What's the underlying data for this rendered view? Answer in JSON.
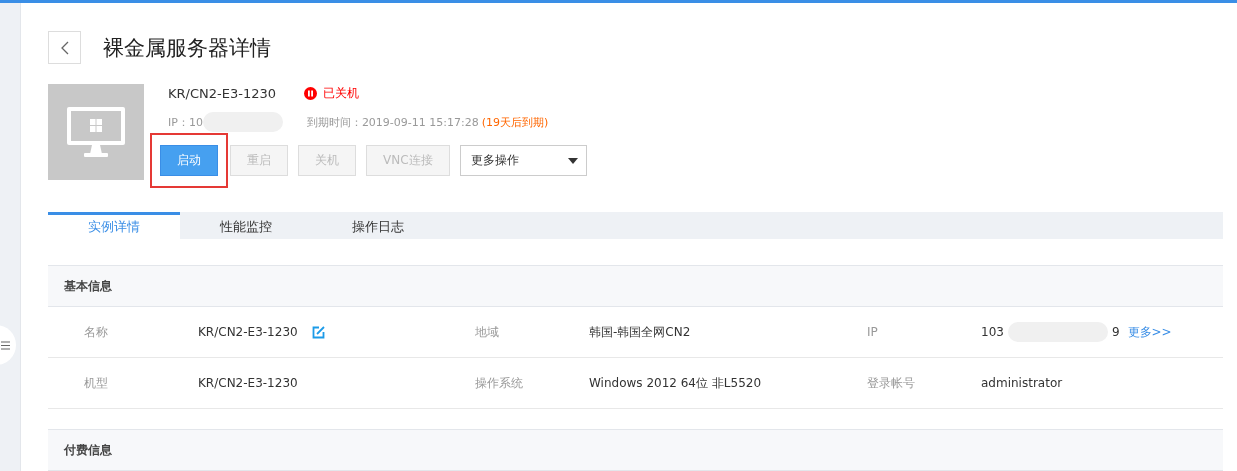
{
  "page": {
    "title": "裸金属服务器详情"
  },
  "server": {
    "name": "KR/CN2-E3-1230",
    "status": {
      "label": "已关机",
      "kind": "stopped"
    },
    "ip_label": "IP：10",
    "ip_redacted": true,
    "expiry_label": "到期时间：2019-09-11 15:17:28",
    "expiry_note": "(19天后到期)"
  },
  "actions": [
    {
      "label": "启动",
      "disabled": false,
      "highlighted": true
    },
    {
      "label": "重启",
      "disabled": true,
      "highlighted": false
    },
    {
      "label": "关机",
      "disabled": true,
      "highlighted": false
    },
    {
      "label": "VNC连接",
      "disabled": true,
      "highlighted": false
    }
  ],
  "more_dropdown": {
    "value": "更多操作"
  },
  "tabs": [
    {
      "label": "实例详情",
      "selected": true
    },
    {
      "label": "性能监控",
      "selected": false
    },
    {
      "label": "操作日志",
      "selected": false
    }
  ],
  "sections": [
    {
      "title": "基本信息",
      "rows": [
        [
          {
            "label": "名称",
            "value": "KR/CN2-E3-1230",
            "editable": true
          },
          {
            "label": "地域",
            "value": "韩国-韩国全网CN2"
          },
          {
            "label": "IP",
            "value": "103",
            "value_end": "9",
            "redacted": true,
            "link": "更多>>"
          }
        ],
        [
          {
            "label": "机型",
            "value": "KR/CN2-E3-1230"
          },
          {
            "label": "操作系统",
            "value": "Windows 2012 64位 非L5520"
          },
          {
            "label": "登录帐号",
            "value": "administrator"
          }
        ]
      ]
    },
    {
      "title": "付费信息"
    }
  ]
}
